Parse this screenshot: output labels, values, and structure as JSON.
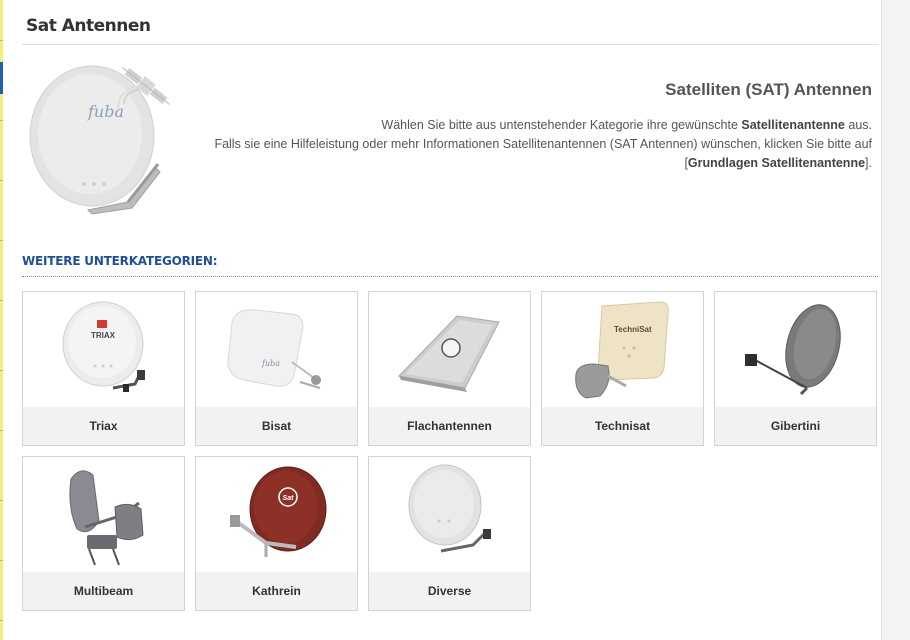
{
  "page": {
    "title": "Sat Antennen"
  },
  "intro": {
    "heading": "Satelliten (SAT) Antennen",
    "line1_before": "Wählen Sie bitte aus untenstehender Kategorie ihre gewünschte ",
    "line1_bold": "Satellitenantenne",
    "line1_after": " aus.",
    "line2_before": "Falls sie eine Hilfeleistung oder mehr Informationen Satellitenantennen (SAT Antennen) wünschen, klicken Sie bitte auf [",
    "line2_link": "Grundlagen Satellitenantenne",
    "line2_after": "].",
    "hero_brand": "fuba"
  },
  "subcategories": {
    "heading": "WEITERE UNTERKATEGORIEN:",
    "items": [
      {
        "label": "Triax",
        "icon": "triax-dish-icon",
        "dish_color": "#e9e9e9",
        "brand": "TRIAX"
      },
      {
        "label": "Bisat",
        "icon": "bisat-dish-icon",
        "dish_color": "#f1f1f1",
        "brand": "fuba"
      },
      {
        "label": "Flachantennen",
        "icon": "flat-antenna-icon",
        "dish_color": "#c9c9c9",
        "brand": ""
      },
      {
        "label": "Technisat",
        "icon": "technisat-dish-icon",
        "dish_color": "#ece0c3",
        "brand": "TechniSat"
      },
      {
        "label": "Gibertini",
        "icon": "gibertini-dish-icon",
        "dish_color": "#7a7a7a",
        "brand": ""
      },
      {
        "label": "Multibeam",
        "icon": "multibeam-dish-icon",
        "dish_color": "#8a8a92",
        "brand": ""
      },
      {
        "label": "Kathrein",
        "icon": "kathrein-dish-icon",
        "dish_color": "#7f2a22",
        "brand": "Sat"
      },
      {
        "label": "Diverse",
        "icon": "diverse-dish-icon",
        "dish_color": "#e2e2e2",
        "brand": ""
      }
    ]
  }
}
